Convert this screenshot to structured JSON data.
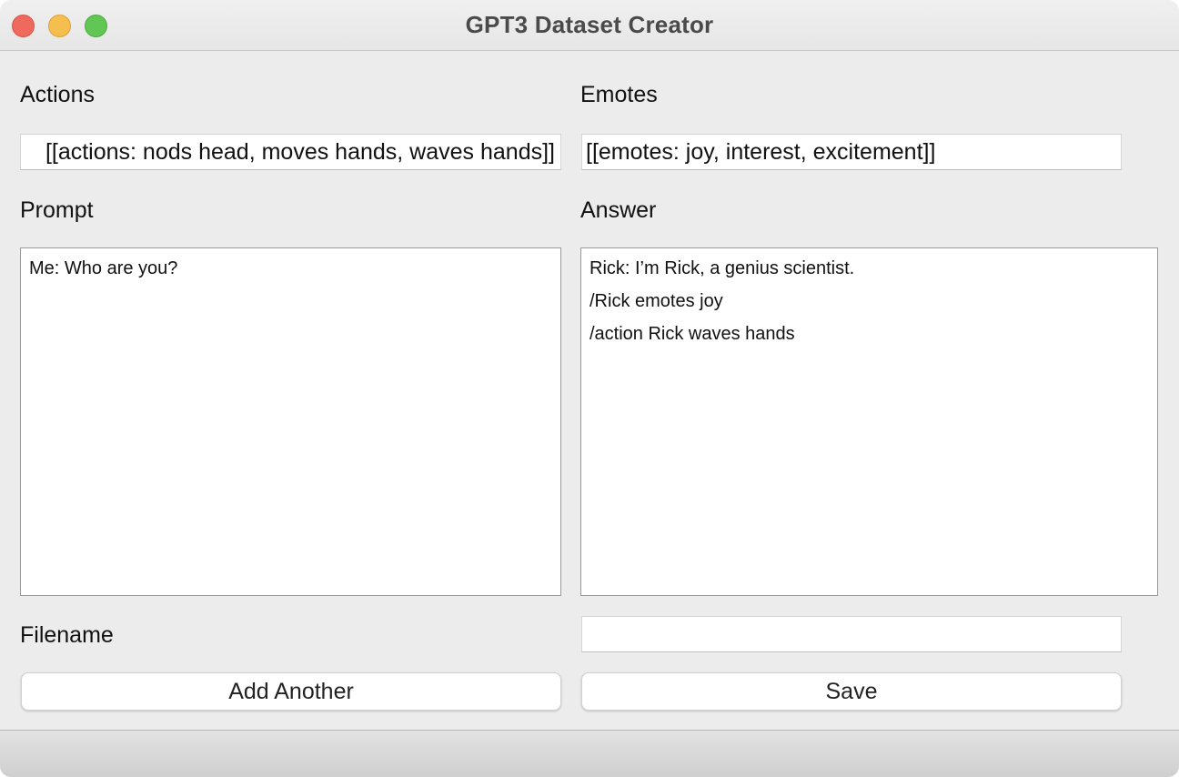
{
  "window": {
    "title": "GPT3 Dataset Creator",
    "traffic_lights": {
      "close_color": "#ee6a5f",
      "minimize_color": "#f5be4f",
      "zoom_color": "#62c655"
    }
  },
  "actions": {
    "label": "Actions",
    "value": "[[actions: nods head, moves hands, waves hands]]"
  },
  "emotes": {
    "label": "Emotes",
    "value": "[[emotes: joy, interest, excitement]]"
  },
  "prompt": {
    "label": "Prompt",
    "lines": [
      "Me: Who are you?"
    ]
  },
  "answer": {
    "label": "Answer",
    "lines": [
      "Rick: I’m Rick, a genius scientist.",
      "/Rick emotes joy",
      "/action Rick waves hands"
    ]
  },
  "filename": {
    "label": "Filename",
    "value": ""
  },
  "buttons": {
    "add_another": "Add Another",
    "save": "Save"
  }
}
